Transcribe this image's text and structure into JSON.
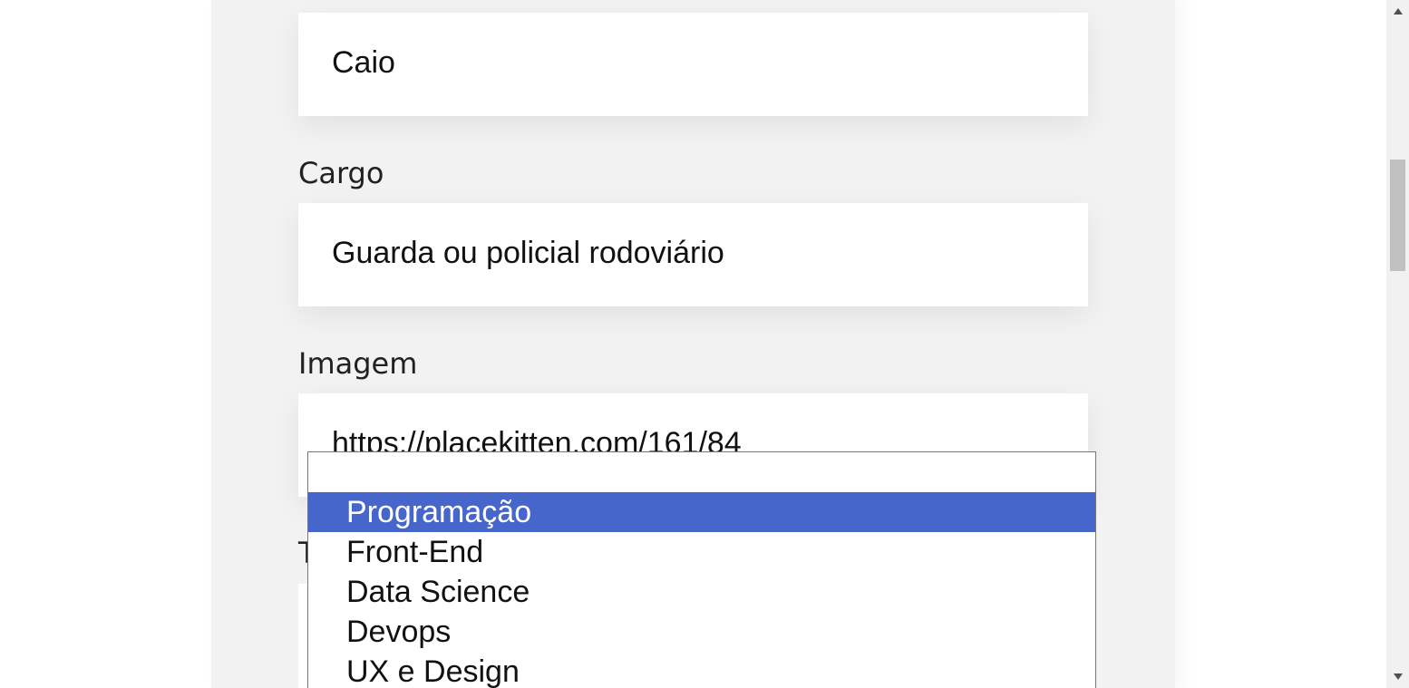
{
  "form": {
    "nome_value": "Caio",
    "cargo_label": "Cargo",
    "cargo_value": "Guarda ou policial rodoviário",
    "imagem_label": "Imagem",
    "imagem_value": "https://placekitten.com/161/84",
    "time_label_fragment": "T"
  },
  "time_dropdown": {
    "options": [
      {
        "label": ""
      },
      {
        "label": "Programação",
        "selected": true
      },
      {
        "label": "Front-End"
      },
      {
        "label": "Data Science"
      },
      {
        "label": "Devops"
      },
      {
        "label": "UX e Design"
      }
    ],
    "selected_color": "#4766cb"
  },
  "scrollbar": {
    "up_icon": "triangle-up-icon",
    "down_icon": "triangle-down-icon"
  }
}
